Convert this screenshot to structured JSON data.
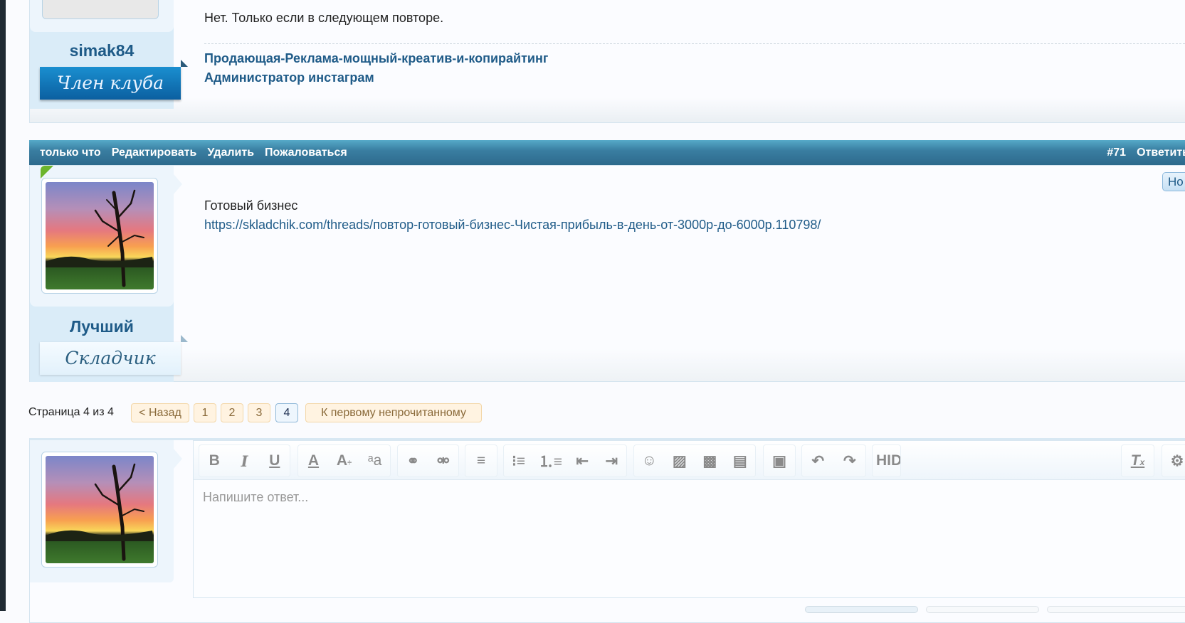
{
  "post1": {
    "text": "Нет. Только если в следующем повторе.",
    "username": "simak84",
    "badge": "Член клуба",
    "signature": [
      "Продающая-Реклама-мощный-креатив-и-копирайтинг",
      "Администратор инстаграм"
    ]
  },
  "post2": {
    "header": {
      "time": "только что",
      "edit": "Редактировать",
      "delete": "Удалить",
      "report": "Пожаловаться",
      "number": "#71",
      "reply": "Ответить"
    },
    "new_button": "Но",
    "text": "Готовый бизнес",
    "link": "https://skladchik.com/threads/повтор-готовый-бизнес-Чистая-прибыль-в-день-от-3000р-до-6000р.110798/",
    "username": "Лучший",
    "badge": "Складчик"
  },
  "pagination": {
    "label": "Страница 4 из 4",
    "prev": "< Назад",
    "pages": [
      "1",
      "2",
      "3",
      "4"
    ],
    "current": "4",
    "first_unread": "К первому непрочитанному"
  },
  "editor": {
    "placeholder": "Напишите ответ...",
    "hide_label": "HIDE"
  },
  "colors": {
    "accent": "#2d6a8c",
    "link": "#1f5b88"
  }
}
